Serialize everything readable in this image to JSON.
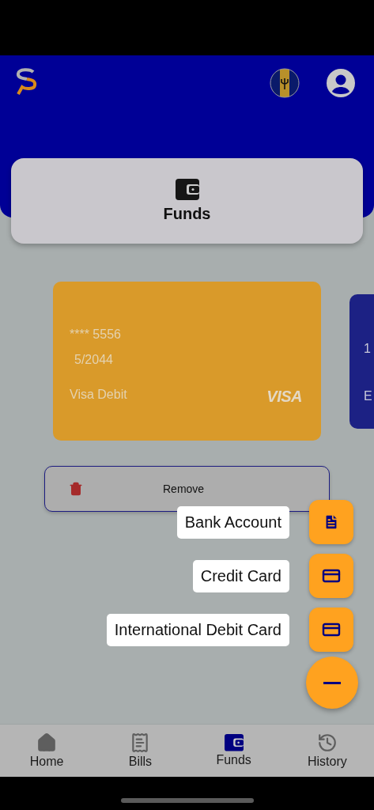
{
  "header": {
    "title": "Funds"
  },
  "cards": [
    {
      "kind": "debit",
      "number": "**** 5556",
      "expiry": "5/2044",
      "type": "Visa Debit",
      "brand": "VISA",
      "color": "#d99a2a"
    },
    {
      "kind": "partial",
      "line_1": "1",
      "line_2": "E",
      "color": "#1c2184"
    }
  ],
  "remove_button": {
    "label": "Remove"
  },
  "fab_menu": {
    "expanded": true,
    "actions": [
      {
        "label": "Bank Account",
        "kind": "document"
      },
      {
        "label": "Credit Card",
        "kind": "card"
      },
      {
        "label": "International Debit Card",
        "kind": "card"
      }
    ]
  },
  "nav": [
    {
      "label": "Home",
      "kind": "home",
      "selected": false
    },
    {
      "label": "Bills",
      "kind": "bills",
      "selected": false
    },
    {
      "label": "Funds",
      "kind": "wallet",
      "selected": true
    },
    {
      "label": "History",
      "kind": "history",
      "selected": false
    }
  ]
}
